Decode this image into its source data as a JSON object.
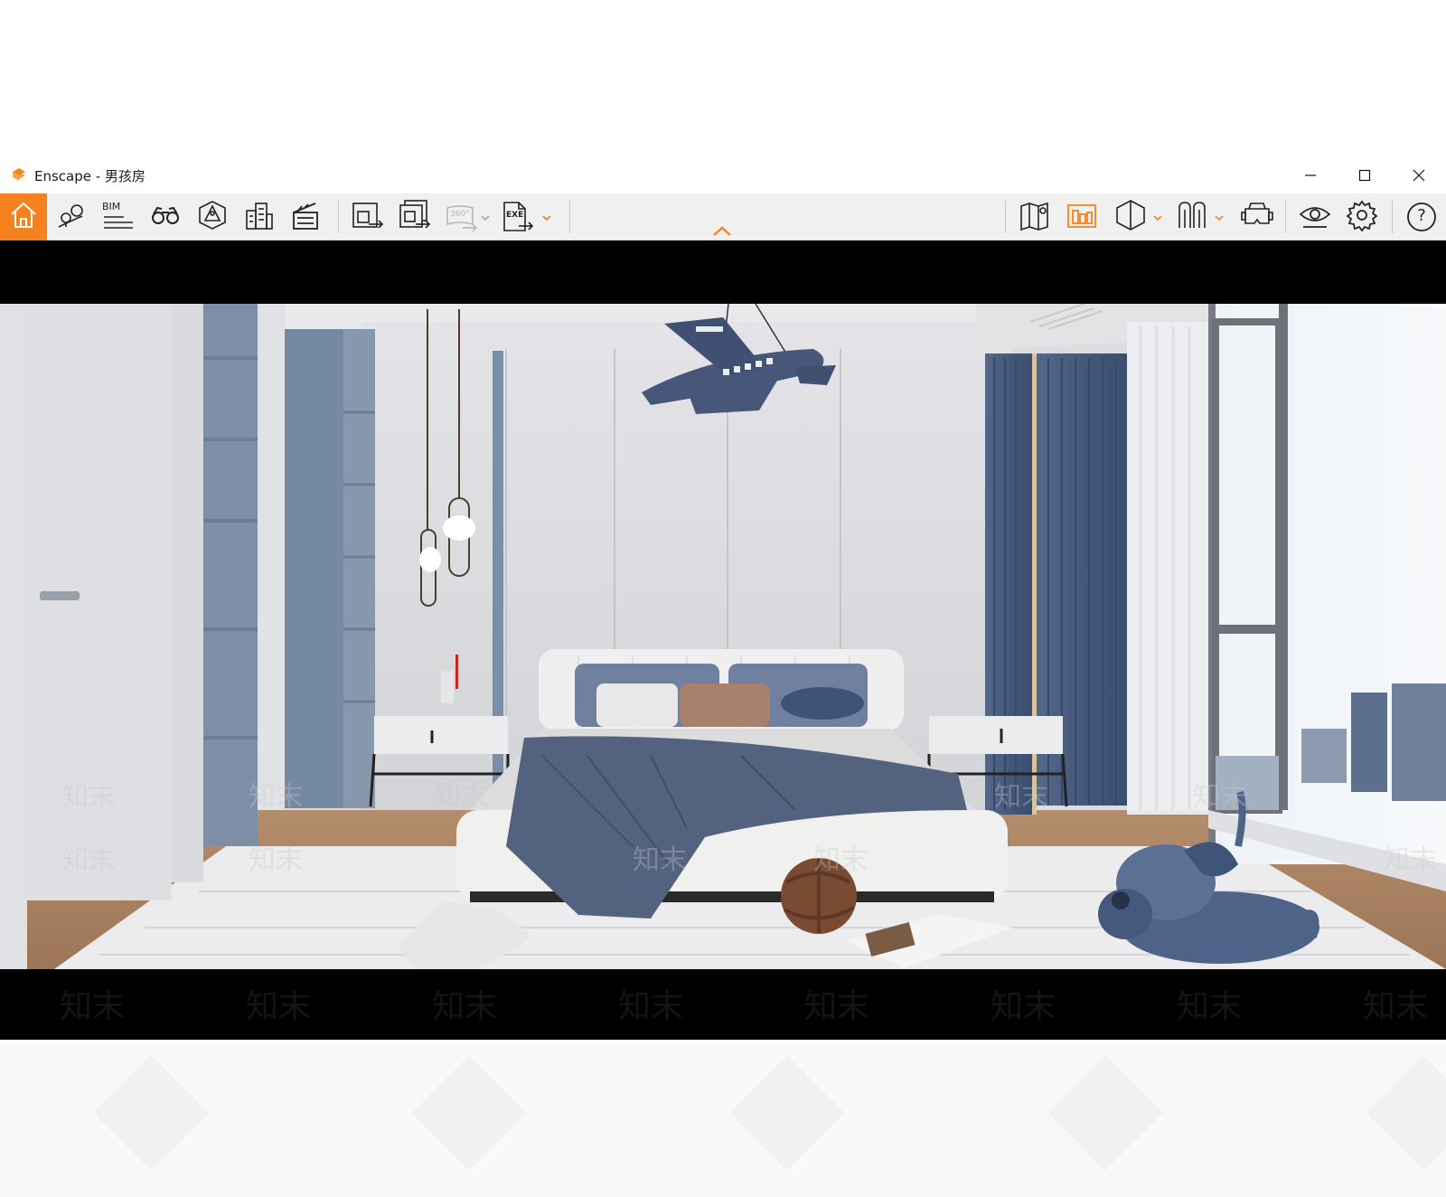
{
  "window": {
    "title": "Enscape - 男孩房"
  },
  "toolbar": {
    "items": [
      {
        "name": "home-icon"
      },
      {
        "name": "location-pins-icon"
      },
      {
        "name": "bim-icon",
        "label": "BIM"
      },
      {
        "name": "binoculars-icon"
      },
      {
        "name": "view-cube-icon"
      },
      {
        "name": "buildings-icon"
      },
      {
        "name": "clapperboard-icon"
      },
      {
        "name": "screenshot-export-icon"
      },
      {
        "name": "batch-export-icon"
      },
      {
        "name": "panorama-export-icon",
        "label": "360°"
      },
      {
        "name": "exe-export-icon",
        "label": "EXE"
      },
      {
        "name": "map-icon"
      },
      {
        "name": "asset-library-icon"
      },
      {
        "name": "section-view-icon"
      },
      {
        "name": "material-editor-icon"
      },
      {
        "name": "vr-headset-icon"
      },
      {
        "name": "eye-icon"
      },
      {
        "name": "gear-icon"
      },
      {
        "name": "help-icon",
        "label": "?"
      }
    ],
    "accent": "#f5821f"
  },
  "watermark": {
    "text": "知末"
  }
}
